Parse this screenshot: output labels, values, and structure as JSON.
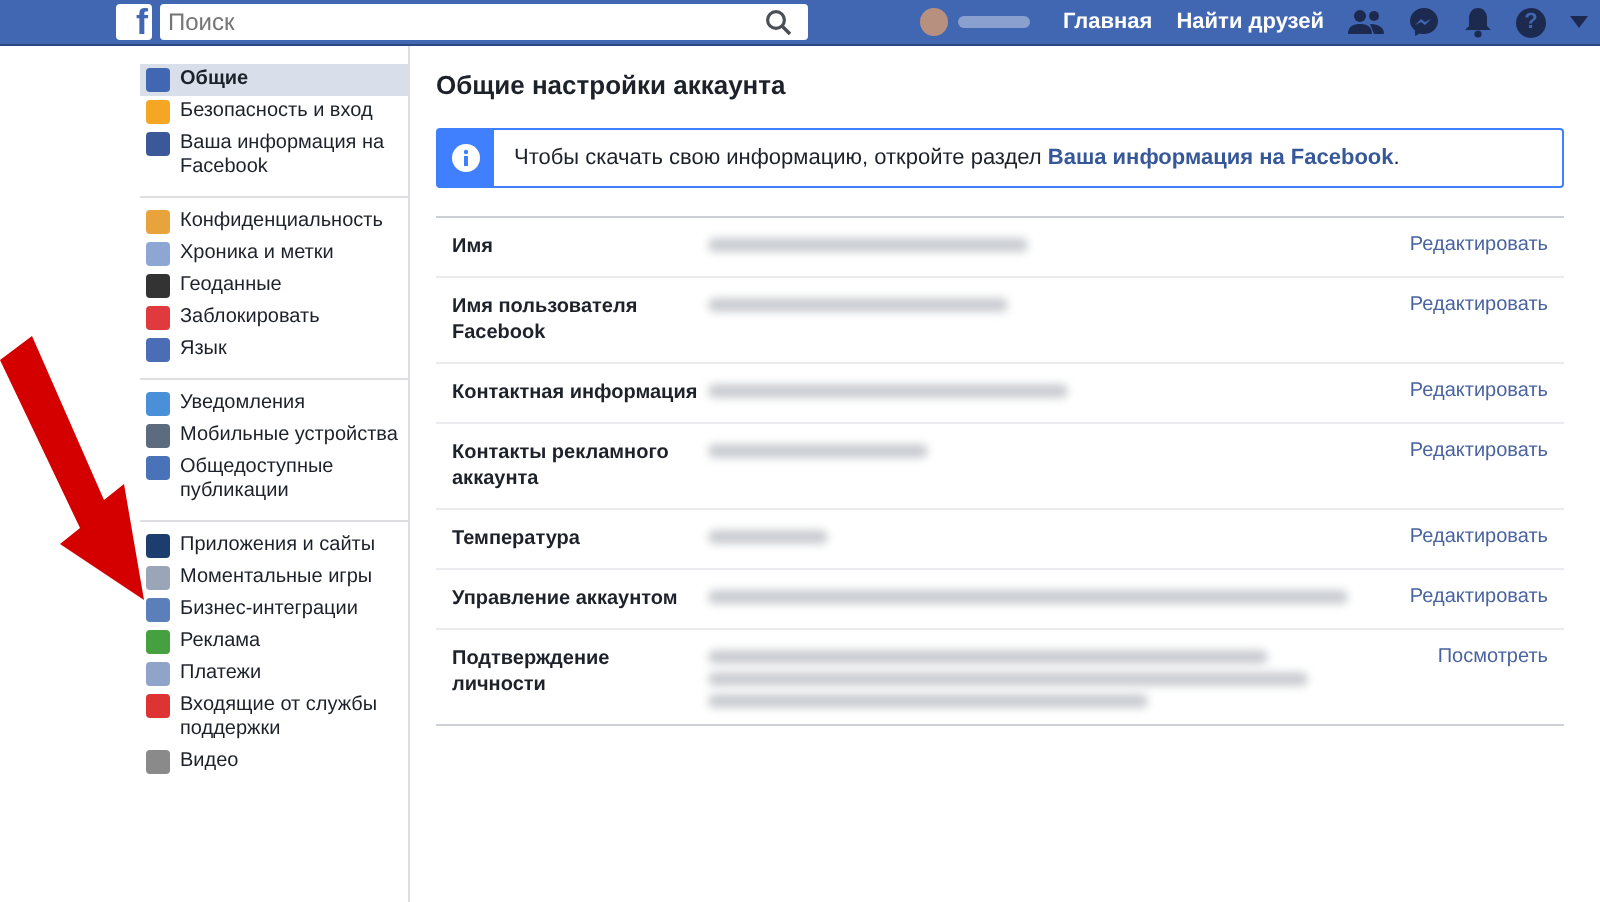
{
  "header": {
    "logo": "f",
    "search": {
      "placeholder": "Поиск"
    },
    "links": [
      "Главная",
      "Найти друзей"
    ],
    "help": "?"
  },
  "sidebar": {
    "groups": [
      [
        {
          "label": "Общие",
          "selected": true
        },
        {
          "label": "Безопасность и вход",
          "selected": false
        },
        {
          "label": "Ваша информация на Facebook",
          "selected": false
        }
      ],
      [
        {
          "label": "Конфиденциальность",
          "selected": false
        },
        {
          "label": "Хроника и метки",
          "selected": false
        },
        {
          "label": "Геоданные",
          "selected": false
        },
        {
          "label": "Заблокировать",
          "selected": false
        },
        {
          "label": "Язык",
          "selected": false
        }
      ],
      [
        {
          "label": "Уведомления",
          "selected": false
        },
        {
          "label": "Мобильные устройства",
          "selected": false
        },
        {
          "label": "Общедоступные публикации",
          "selected": false
        }
      ],
      [
        {
          "label": "Приложения и сайты",
          "selected": false
        },
        {
          "label": "Моментальные игры",
          "selected": false
        },
        {
          "label": "Бизнес-интеграции",
          "selected": false
        },
        {
          "label": "Реклама",
          "selected": false
        },
        {
          "label": "Платежи",
          "selected": false
        },
        {
          "label": "Входящие от службы поддержки",
          "selected": false
        },
        {
          "label": "Видео",
          "selected": false
        }
      ]
    ]
  },
  "content": {
    "title": "Общие настройки аккаунта",
    "notice": {
      "text": "Чтобы скачать свою информацию, откройте раздел",
      "link": "Ваша информация на Facebook",
      "end": "."
    },
    "rows": [
      {
        "label": "Имя",
        "action": "Редактировать"
      },
      {
        "label": "Имя пользователя Facebook",
        "action": "Редактировать"
      },
      {
        "label": "Контактная информация",
        "action": "Редактировать"
      },
      {
        "label": "Контакты рекламного аккаунта",
        "action": "Редактировать"
      },
      {
        "label": "Температура",
        "action": "Редактировать"
      },
      {
        "label": "Управление аккаунтом",
        "action": "Редактировать"
      },
      {
        "label": "Подтверждение личности",
        "action": "Посмотреть"
      }
    ]
  }
}
